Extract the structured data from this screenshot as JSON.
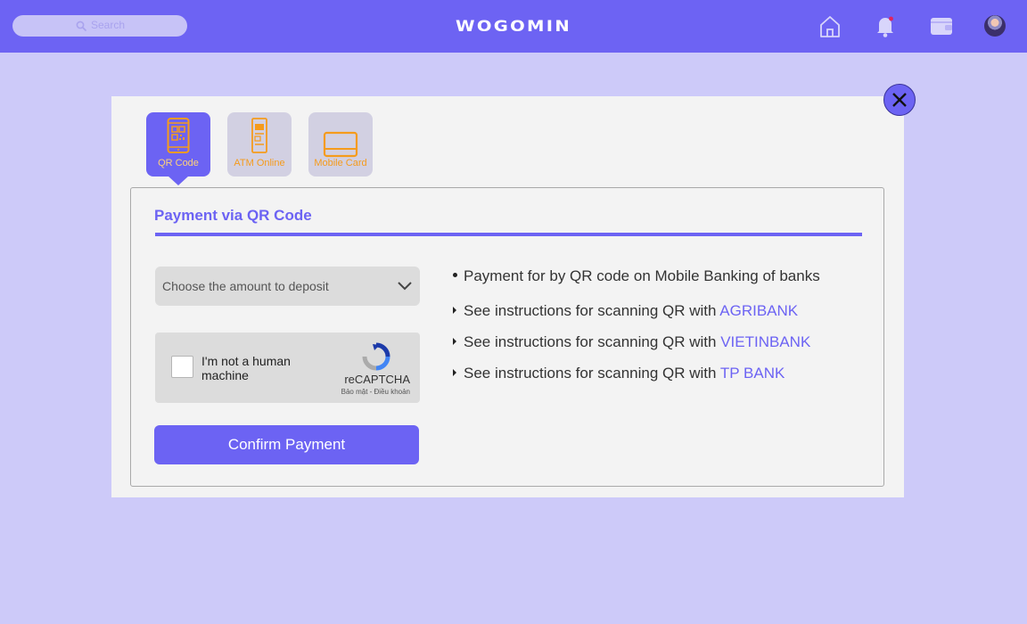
{
  "header": {
    "search_placeholder": "Search",
    "logo": "WOGOMIN",
    "icons": [
      "home-icon",
      "bell-icon",
      "wallet-icon",
      "avatar"
    ],
    "colors": {
      "bar": "#6d63f3",
      "notification_dot": "#e0245e"
    }
  },
  "modal": {
    "tabs": [
      {
        "label": "QR Code",
        "icon": "qr-phone-icon",
        "active": true
      },
      {
        "label": "ATM Online",
        "icon": "atm-icon",
        "active": false
      },
      {
        "label": "Mobile Card",
        "icon": "card-icon",
        "active": false
      }
    ],
    "title": "Payment via QR Code",
    "amount_select": {
      "placeholder": "Choose the amount to deposit"
    },
    "captcha": {
      "label": "I'm not a human machine",
      "brand": "reCAPTCHA",
      "terms": "Bảo mật - Điều khoản"
    },
    "confirm_label": "Confirm Payment",
    "info_text": "Payment for by QR code on Mobile Banking of banks",
    "instructions_prefix": "See instructions for scanning QR with",
    "banks": [
      "AGRIBANK",
      "VIETINBANK",
      "TP BANK"
    ],
    "colors": {
      "accent": "#6c63f3",
      "tab_label": "#f59b1c"
    }
  }
}
